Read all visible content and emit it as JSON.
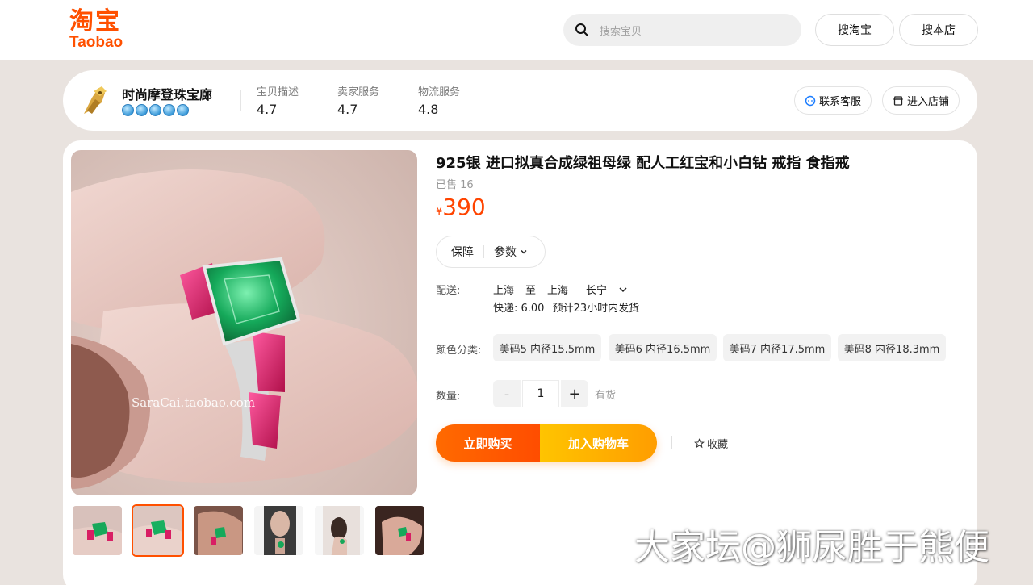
{
  "brand": {
    "logo_cn": "淘宝",
    "logo_en": "Taobao",
    "accent": "#ff5000"
  },
  "search": {
    "placeholder": "搜索宝贝",
    "btn_taobao": "搜淘宝",
    "btn_store": "搜本店"
  },
  "shop": {
    "name": "时尚摩登珠宝廊",
    "crown_count": 5,
    "scores": [
      {
        "label": "宝贝描述",
        "value": "4.7"
      },
      {
        "label": "卖家服务",
        "value": "4.7"
      },
      {
        "label": "物流服务",
        "value": "4.8"
      }
    ],
    "contact_label": "联系客服",
    "enter_label": "进入店铺"
  },
  "product": {
    "title": "925银 进口拟真合成绿祖母绿 配人工红宝和小白钻 戒指 食指戒",
    "sold": "已售 16",
    "currency": "¥",
    "price": "390",
    "image_watermark": "SaraCai.taobao.com",
    "tabs": {
      "guarantee": "保障",
      "params": "参数"
    },
    "shipping": {
      "label": "配送:",
      "from": "上海",
      "to_word": "至",
      "to": "上海",
      "district": "长宁",
      "fee": "快递: 6.00",
      "eta": "预计23小时内发货"
    },
    "color_label": "颜色分类:",
    "skus": [
      "美码5 内径15.5mm",
      "美码6 内径16.5mm",
      "美码7 内径17.5mm",
      "美码8 内径18.3mm"
    ],
    "qty_label": "数量:",
    "qty_minus": "-",
    "qty_value": "1",
    "qty_plus": "+",
    "stock": "有货",
    "buy_now": "立即购买",
    "add_cart": "加入购物车",
    "favorite": "收藏"
  },
  "page_watermark": "大家坛@狮尿胜于熊便"
}
